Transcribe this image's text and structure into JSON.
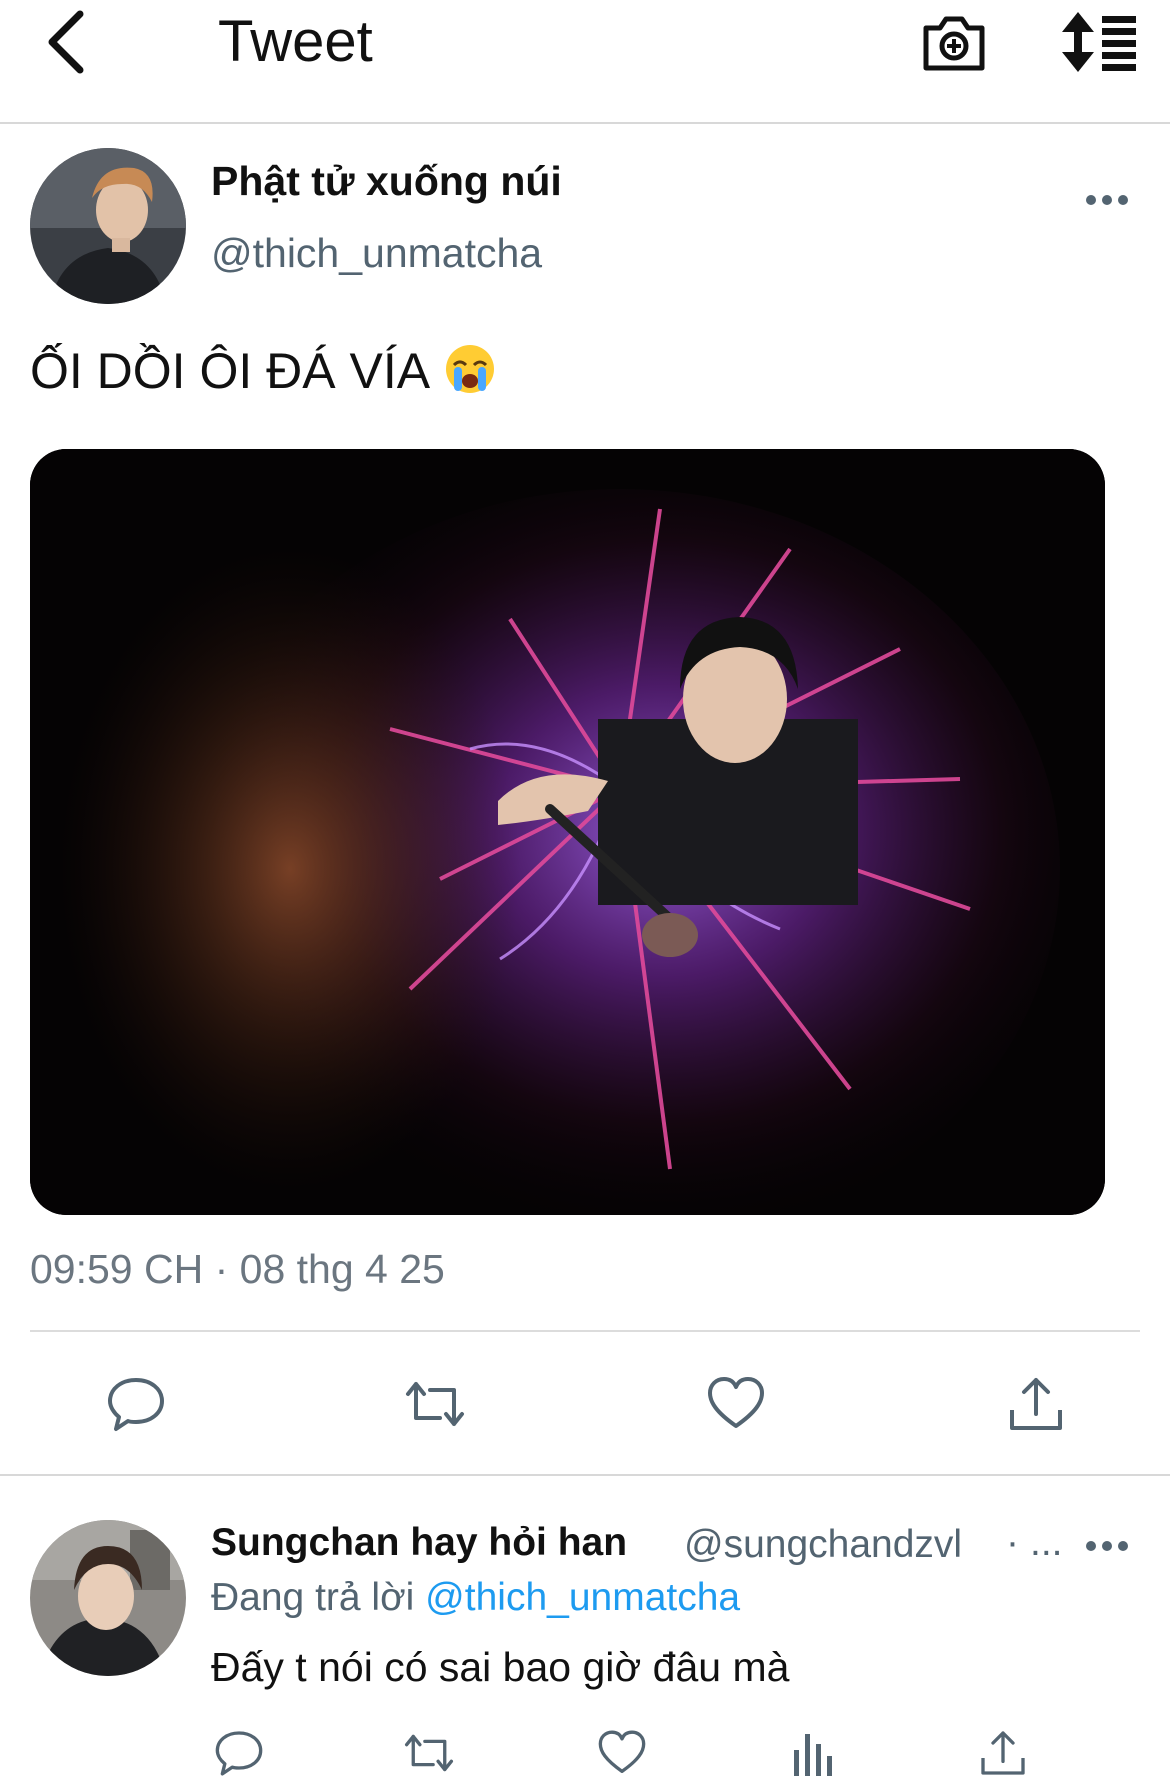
{
  "header": {
    "title": "Tweet",
    "back_icon": "chevron-left-icon",
    "camera_icon": "camera-plus-icon",
    "sort_icon": "sort-list-icon"
  },
  "tweet": {
    "author_name": "Phật tử xuống núi",
    "author_handle": "@thich_unmatcha",
    "text": "ỐI DỒI ÔI ĐÁ VÍA",
    "emoji": "😭",
    "timestamp": "09:59 CH · 08 thg 4 25",
    "actions": [
      "reply-icon",
      "retweet-icon",
      "like-icon",
      "share-icon"
    ]
  },
  "reply": {
    "author_name": "Sungchan hay hỏi han",
    "author_handle": "@sungchandzvl",
    "separator": "·",
    "truncation": "...",
    "replying_prefix": "Đang trả lời",
    "replying_mention": "@thich_unmatcha",
    "text": "Đấy t nói có sai bao giờ đâu mà",
    "actions": [
      "reply-icon",
      "retweet-icon",
      "like-icon",
      "analytics-icon",
      "share-icon"
    ]
  },
  "colors": {
    "text": "#111111",
    "secondary": "#536471",
    "accent": "#1d9bf0",
    "divider": "#dcdcdc"
  }
}
